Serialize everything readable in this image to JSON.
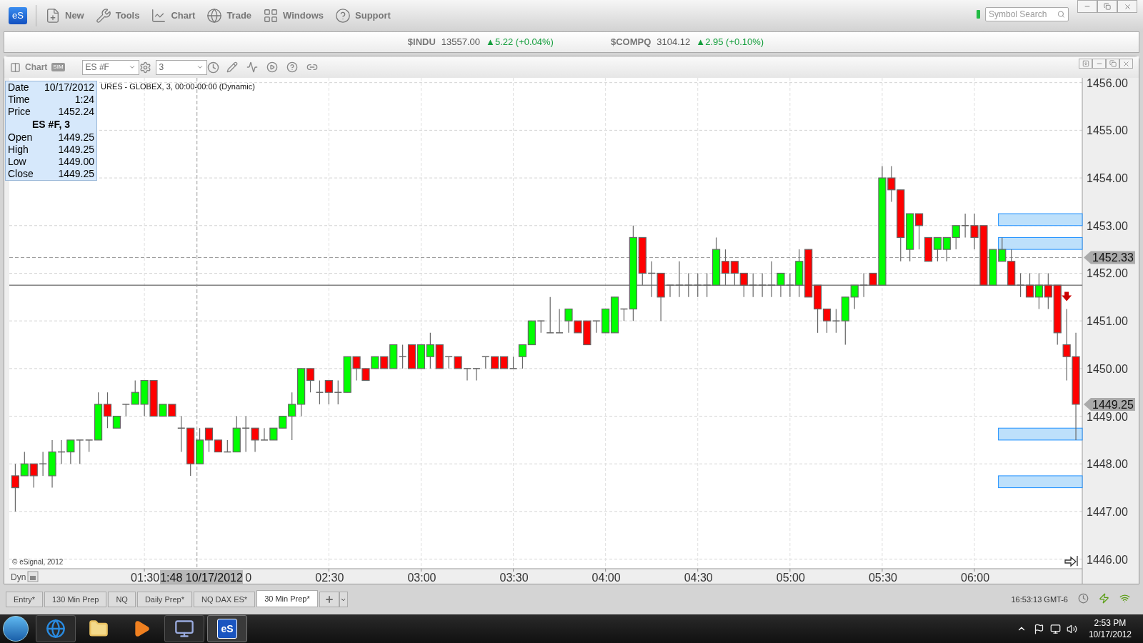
{
  "toolbar": {
    "logo": "eS",
    "items": [
      {
        "label": "New",
        "kind": "new"
      },
      {
        "label": "Tools",
        "kind": "tools"
      },
      {
        "label": "Chart",
        "kind": "chart"
      },
      {
        "label": "Trade",
        "kind": "trade"
      },
      {
        "label": "Windows",
        "kind": "windows"
      },
      {
        "label": "Support",
        "kind": "support"
      }
    ],
    "symbol_search": {
      "placeholder": "Symbol Search"
    }
  },
  "tickers": [
    {
      "symbol": "$INDU",
      "value": "13557.00",
      "arrow": "▲",
      "change": "5.22 (+0.04%)",
      "color": "#149e3c"
    },
    {
      "symbol": "$COMPQ",
      "value": "3104.12",
      "arrow": "▲",
      "change": "2.95 (+0.10%)",
      "color": "#149e3c"
    }
  ],
  "chart_window": {
    "title": "Chart",
    "badge": "SIM",
    "symbol": "ES #F",
    "interval": "3",
    "study_title": "URES - GLOBEX, 3, 00:00-00:00 (Dynamic)",
    "copyright": "© eSignal, 2012",
    "axis_mode": "Dyn",
    "crosshair_label": "1:48 10/17/2012",
    "info_box": {
      "rows": [
        {
          "label": "Date",
          "value": "10/17/2012"
        },
        {
          "label": "Time",
          "value": "1:24"
        },
        {
          "label": "Price",
          "value": "1452.24"
        }
      ],
      "ohlc": [
        {
          "label": "Open",
          "value": "1449.25"
        },
        {
          "label": "High",
          "value": "1449.25"
        },
        {
          "label": "Low",
          "value": "1449.00"
        },
        {
          "label": "Close",
          "value": "1449.25"
        }
      ]
    },
    "last_price_label": "1449.25",
    "covered_tick_label": "0",
    "chart_data": {
      "type": "candlestick",
      "title": "ES #F, 3",
      "ylim": [
        1445.8,
        1456.1
      ],
      "grid": true,
      "yticks": [
        {
          "value": 1456,
          "label": "1456.00"
        },
        {
          "value": 1455,
          "label": "1455.00"
        },
        {
          "value": 1454,
          "label": "1454.00"
        },
        {
          "value": 1453,
          "label": "1453.00"
        },
        {
          "value": 1452,
          "label": "1452.00"
        },
        {
          "value": 1451,
          "label": "1451.00"
        },
        {
          "value": 1450,
          "label": "1450.00"
        },
        {
          "value": 1449,
          "label": "1449.00"
        },
        {
          "value": 1448,
          "label": "1448.00"
        },
        {
          "value": 1447,
          "label": "1447.00"
        },
        {
          "value": 1446,
          "label": "1446.00"
        }
      ],
      "categories": [
        null,
        null,
        null,
        null,
        null,
        null,
        null,
        null,
        null,
        null,
        null,
        null,
        null,
        null,
        "01:30",
        null,
        null,
        null,
        null,
        null,
        null,
        null,
        null,
        null,
        null,
        null,
        null,
        null,
        null,
        null,
        null,
        null,
        null,
        null,
        "02:30",
        null,
        null,
        null,
        null,
        null,
        null,
        null,
        null,
        null,
        "03:00",
        null,
        null,
        null,
        null,
        null,
        null,
        null,
        null,
        null,
        "03:30",
        null,
        null,
        null,
        null,
        null,
        null,
        null,
        null,
        null,
        "04:00",
        null,
        null,
        null,
        null,
        null,
        null,
        null,
        null,
        null,
        "04:30",
        null,
        null,
        null,
        null,
        null,
        null,
        null,
        null,
        null,
        "05:00",
        null,
        null,
        null,
        null,
        null,
        null,
        null,
        null,
        null,
        "05:30",
        null,
        null,
        null,
        null,
        null,
        null,
        null,
        null,
        null,
        "06:00",
        null,
        null,
        null,
        null,
        null,
        null,
        null,
        null,
        null,
        null,
        null
      ],
      "bands": [
        {
          "axis": "y",
          "from": 1453,
          "to": 1453.25
        },
        {
          "axis": "y",
          "from": 1452.5,
          "to": 1452.75
        },
        {
          "axis": "y",
          "from": 1448.5,
          "to": 1448.75
        },
        {
          "axis": "y",
          "from": 1447.5,
          "to": 1447.75
        }
      ],
      "ref_lines": [
        {
          "axis": "y",
          "value": 1451.75
        },
        {
          "axis": "y",
          "value": 1452.33,
          "label": "1452.33"
        }
      ],
      "ohlc": [
        [
          1447.75,
          1448,
          1447,
          1447.5
        ],
        [
          1447.75,
          1448.25,
          1447.75,
          1448
        ],
        [
          1448,
          1448,
          1447.5,
          1447.75
        ],
        [
          1448,
          1448.25,
          1447.75,
          1448
        ],
        [
          1447.75,
          1448.5,
          1447.5,
          1448.25
        ],
        [
          1448.25,
          1448.5,
          1448,
          1448.25
        ],
        [
          1448.25,
          1448.5,
          1448,
          1448.5
        ],
        [
          1448.5,
          1448.5,
          1448,
          1448.5
        ],
        [
          1448.5,
          1448.5,
          1448.25,
          1448.5
        ],
        [
          1448.5,
          1449.5,
          1448.5,
          1449.25
        ],
        [
          1449.25,
          1449.5,
          1448.75,
          1449
        ],
        [
          1448.75,
          1449,
          1448.75,
          1449
        ],
        [
          1449.25,
          1449.25,
          1449,
          1449.25
        ],
        [
          1449.25,
          1449.75,
          1449.25,
          1449.5
        ],
        [
          1449.25,
          1449.75,
          1449,
          1449.75
        ],
        [
          1449.75,
          1449.75,
          1449,
          1449
        ],
        [
          1449,
          1449.25,
          1449,
          1449.25
        ],
        [
          1449.25,
          1449.25,
          1449,
          1449
        ],
        [
          1448.75,
          1449,
          1448.25,
          1448.75
        ],
        [
          1448.75,
          1448.75,
          1447.75,
          1448
        ],
        [
          1448,
          1448.75,
          1448,
          1448.5
        ],
        [
          1448.75,
          1448.75,
          1448.25,
          1448.5
        ],
        [
          1448.5,
          1448.5,
          1448.25,
          1448.25
        ],
        [
          1448.25,
          1448.5,
          1448.25,
          1448.25
        ],
        [
          1448.25,
          1449,
          1448.25,
          1448.75
        ],
        [
          1448.75,
          1449,
          1448.25,
          1448.75
        ],
        [
          1448.75,
          1448.75,
          1448.25,
          1448.5
        ],
        [
          1448.5,
          1448.75,
          1448.5,
          1448.5
        ],
        [
          1448.5,
          1448.75,
          1448.5,
          1448.75
        ],
        [
          1448.75,
          1449,
          1448.75,
          1449
        ],
        [
          1449,
          1449.5,
          1448.5,
          1449.25
        ],
        [
          1449.25,
          1450,
          1449,
          1450
        ],
        [
          1450,
          1450,
          1449.5,
          1449.75
        ],
        [
          1449.5,
          1449.75,
          1449.25,
          1449.5
        ],
        [
          1449.75,
          1449.75,
          1449.25,
          1449.5
        ],
        [
          1449.5,
          1449.75,
          1449.25,
          1449.5
        ],
        [
          1449.5,
          1450.25,
          1449.5,
          1450.25
        ],
        [
          1450.25,
          1450.25,
          1449.75,
          1450
        ],
        [
          1450,
          1450,
          1449.75,
          1449.75
        ],
        [
          1450,
          1450.25,
          1450,
          1450.25
        ],
        [
          1450.25,
          1450.25,
          1450,
          1450
        ],
        [
          1450,
          1450.5,
          1450,
          1450.5
        ],
        [
          1450.25,
          1450.5,
          1450,
          1450.25
        ],
        [
          1450.5,
          1450.5,
          1450,
          1450
        ],
        [
          1450,
          1450.5,
          1450,
          1450.5
        ],
        [
          1450.25,
          1450.75,
          1450,
          1450.5
        ],
        [
          1450.5,
          1450.5,
          1450,
          1450
        ],
        [
          1450.25,
          1450.25,
          1450,
          1450.25
        ],
        [
          1450.25,
          1450.25,
          1450,
          1450
        ],
        [
          1450,
          1450,
          1449.75,
          1450
        ],
        [
          1450,
          1450,
          1449.75,
          1450
        ],
        [
          1450.25,
          1450.25,
          1450,
          1450.25
        ],
        [
          1450.25,
          1450.25,
          1450,
          1450
        ],
        [
          1450.25,
          1450.25,
          1450,
          1450
        ],
        [
          1450,
          1450.25,
          1450,
          1450
        ],
        [
          1450.25,
          1450.5,
          1450,
          1450.5
        ],
        [
          1450.5,
          1451,
          1450.5,
          1451
        ],
        [
          1451,
          1451,
          1450.75,
          1451
        ],
        [
          1450.75,
          1451.5,
          1450.75,
          1450.75
        ],
        [
          1450.75,
          1451.25,
          1450.75,
          1450.75
        ],
        [
          1451,
          1451.25,
          1450.75,
          1451.25
        ],
        [
          1451,
          1451,
          1450.75,
          1450.75
        ],
        [
          1451,
          1451,
          1450.5,
          1450.5
        ],
        [
          1451,
          1451,
          1450.75,
          1451
        ],
        [
          1450.75,
          1451.25,
          1450.75,
          1451.25
        ],
        [
          1450.75,
          1451.5,
          1450.75,
          1451.5
        ],
        [
          1451.25,
          1451.25,
          1451,
          1451.25
        ],
        [
          1451.25,
          1453,
          1451,
          1452.75
        ],
        [
          1452.75,
          1452.75,
          1451.75,
          1452
        ],
        [
          1452,
          1452.25,
          1451.5,
          1452
        ],
        [
          1452,
          1452,
          1451,
          1451.5
        ],
        [
          1451.75,
          1451.75,
          1451.5,
          1451.75
        ],
        [
          1451.75,
          1452.25,
          1451.5,
          1451.75
        ],
        [
          1451.75,
          1452,
          1451.5,
          1451.75
        ],
        [
          1451.75,
          1452,
          1451.5,
          1451.75
        ],
        [
          1451.75,
          1452,
          1451.5,
          1451.75
        ],
        [
          1451.75,
          1452.75,
          1451.75,
          1452.5
        ],
        [
          1452.25,
          1452.5,
          1451.75,
          1452
        ],
        [
          1452.25,
          1452.25,
          1451.75,
          1452
        ],
        [
          1452,
          1452,
          1451.5,
          1451.75
        ],
        [
          1451.75,
          1452,
          1451.5,
          1451.75
        ],
        [
          1451.75,
          1452,
          1451.5,
          1451.75
        ],
        [
          1451.75,
          1452.25,
          1451.5,
          1451.75
        ],
        [
          1451.75,
          1452,
          1451.5,
          1452
        ],
        [
          1451.75,
          1452,
          1451.5,
          1451.75
        ],
        [
          1451.75,
          1452.5,
          1451.5,
          1452.25
        ],
        [
          1452.5,
          1452.5,
          1451.5,
          1451.5
        ],
        [
          1451.75,
          1451.75,
          1450.75,
          1451.25
        ],
        [
          1451.25,
          1451.25,
          1450.75,
          1451
        ],
        [
          1451,
          1451.25,
          1450.75,
          1451
        ],
        [
          1451,
          1451.5,
          1450.5,
          1451.5
        ],
        [
          1451.5,
          1451.75,
          1451.25,
          1451.75
        ],
        [
          1451.75,
          1452,
          1451.5,
          1451.75
        ],
        [
          1452,
          1452,
          1451.75,
          1451.75
        ],
        [
          1451.75,
          1454.25,
          1451.75,
          1454
        ],
        [
          1454,
          1454.25,
          1453.5,
          1453.75
        ],
        [
          1453.75,
          1453.75,
          1452.25,
          1452.75
        ],
        [
          1452.5,
          1453.25,
          1452.25,
          1453.25
        ],
        [
          1453.25,
          1453.25,
          1452.5,
          1453
        ],
        [
          1452.75,
          1452.75,
          1452.25,
          1452.25
        ],
        [
          1452.5,
          1452.75,
          1452.25,
          1452.75
        ],
        [
          1452.5,
          1452.75,
          1452.25,
          1452.75
        ],
        [
          1452.75,
          1453,
          1452.5,
          1453
        ],
        [
          1453,
          1453.25,
          1452.75,
          1453
        ],
        [
          1453,
          1453.25,
          1452.5,
          1452.75
        ],
        [
          1453,
          1453,
          1451.75,
          1451.75
        ],
        [
          1451.75,
          1452.5,
          1451.75,
          1452.5
        ],
        [
          1452.25,
          1452.75,
          1452.25,
          1452.5
        ],
        [
          1452.25,
          1452.5,
          1451.75,
          1451.75
        ],
        [
          1451.75,
          1452,
          1451.5,
          1451.75
        ],
        [
          1451.75,
          1452,
          1451.5,
          1451.5
        ],
        [
          1451.5,
          1452,
          1451.25,
          1451.75
        ],
        [
          1451.75,
          1452,
          1451.25,
          1451.5
        ],
        [
          1451.75,
          1451.75,
          1450.5,
          1450.75
        ],
        [
          1450.5,
          1451.25,
          1449.75,
          1450.25
        ],
        [
          1450.25,
          1450.75,
          1448.5,
          1449.25
        ]
      ]
    }
  },
  "tabs": [
    {
      "label": "Entry*",
      "selected": false
    },
    {
      "label": "130 Min Prep",
      "selected": false
    },
    {
      "label": "NQ",
      "selected": false
    },
    {
      "label": "Daily Prep*",
      "selected": false
    },
    {
      "label": "NQ DAX ES*",
      "selected": false
    },
    {
      "label": "30 Min Prep*",
      "selected": true
    }
  ],
  "status_bar": {
    "time": "16:53:13 GMT-6"
  },
  "taskbar": {
    "apps": [
      {
        "kind": "browser",
        "selected": false
      },
      {
        "kind": "folder",
        "selected": false
      },
      {
        "kind": "media",
        "selected": false
      },
      {
        "kind": "network",
        "selected": false
      },
      {
        "kind": "esignal",
        "label": "eS",
        "selected": true
      }
    ],
    "clock": {
      "time": "2:53 PM",
      "date": "10/17/2012"
    }
  }
}
